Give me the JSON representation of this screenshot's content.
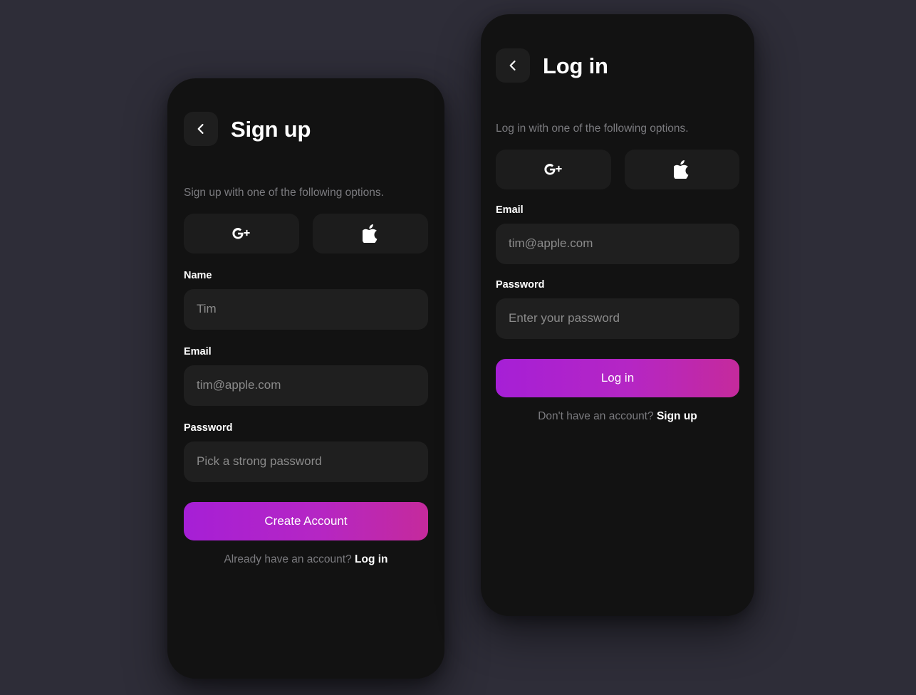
{
  "theme": {
    "page_background": "#2e2d38",
    "card_background": "#121212",
    "input_background": "#1f1f1f",
    "social_button_background": "#1c1c1c",
    "back_button_background": "#1e1e1e",
    "muted_text": "#7b7b7f",
    "placeholder_text": "#8b8b8b",
    "primary_text": "#ffffff",
    "cta_gradient_start": "#a61fd6",
    "cta_gradient_end": "#c52a9c"
  },
  "signup_card": {
    "back_button_icon": "chevron-left-icon",
    "title": "Sign up",
    "subtitle": "Sign up with one of the following options.",
    "social_buttons": [
      {
        "icon": "google-plus-icon",
        "label": "G+"
      },
      {
        "icon": "apple-icon",
        "label": "Apple"
      }
    ],
    "fields": [
      {
        "label": "Name",
        "value": "",
        "placeholder": "Tim"
      },
      {
        "label": "Email",
        "value": "",
        "placeholder": "tim@apple.com"
      },
      {
        "label": "Password",
        "value": "",
        "placeholder": "Pick a strong password"
      }
    ],
    "cta_label": "Create Account",
    "footer_text": "Already have an account?",
    "footer_link": "Log in"
  },
  "login_card": {
    "back_button_icon": "chevron-left-icon",
    "title": "Log in",
    "subtitle": "Log in with one of the following options.",
    "social_buttons": [
      {
        "icon": "google-plus-icon",
        "label": "G+"
      },
      {
        "icon": "apple-icon",
        "label": "Apple"
      }
    ],
    "fields": [
      {
        "label": "Email",
        "value": "",
        "placeholder": "tim@apple.com"
      },
      {
        "label": "Password",
        "value": "",
        "placeholder": "Enter your password"
      }
    ],
    "cta_label": "Log in",
    "footer_text": "Don't have an account?",
    "footer_link": "Sign up"
  }
}
